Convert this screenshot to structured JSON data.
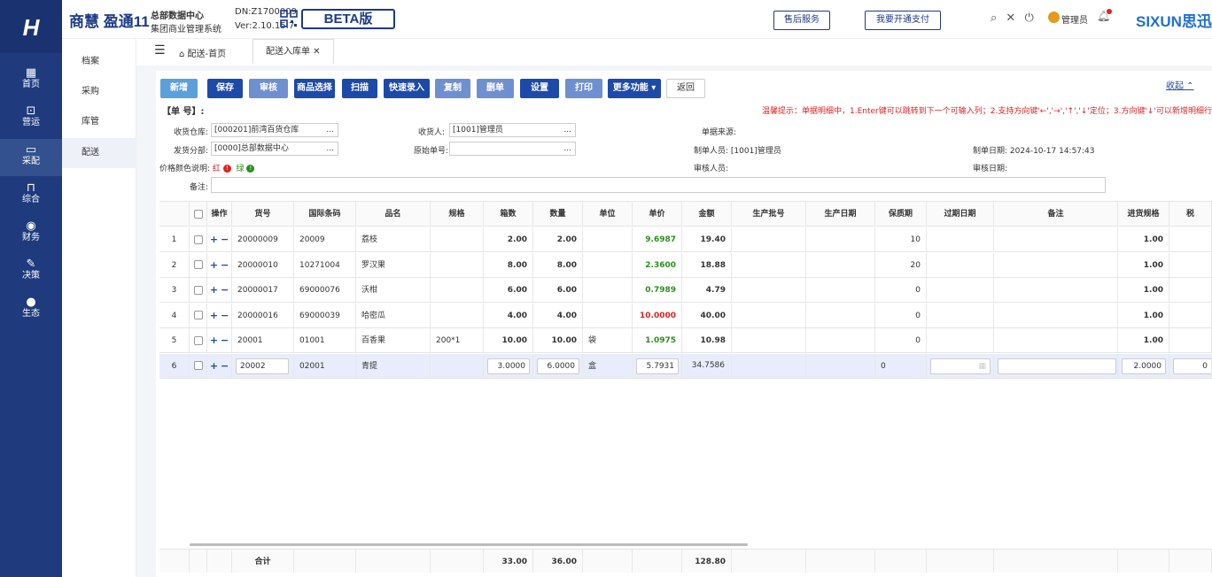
{
  "app": {
    "logo": "H",
    "brand": "商慧 盈通11",
    "company_line1": "总部数据中心",
    "company_line2": "集团商业管理系统",
    "dn": "DN:Z1700009",
    "version": "Ver:2.10.15.7",
    "beta": "BETA版",
    "after_sales": "售后服务",
    "open_payment": "我要开通支付",
    "user": "管理员",
    "vendor_logo": "SIXUN思迅"
  },
  "sidebar": {
    "items": [
      {
        "label": "首页",
        "icon": "▦"
      },
      {
        "label": "营运",
        "icon": "⊡"
      },
      {
        "label": "采配",
        "icon": "▭"
      },
      {
        "label": "综合",
        "icon": "⊓"
      },
      {
        "label": "财务",
        "icon": "◉"
      },
      {
        "label": "决策",
        "icon": "✎"
      },
      {
        "label": "生态",
        "icon": "●"
      }
    ],
    "submenu": [
      "档案",
      "采购",
      "库管",
      "配送"
    ]
  },
  "tabs": {
    "home": "配送-首页",
    "current": "配送入库单 ✕"
  },
  "toolbar": {
    "new": "新增",
    "save": "保存",
    "audit": "审核",
    "select_goods": "商品选择",
    "scan": "扫描",
    "quick_entry": "快速录入",
    "copy": "复制",
    "delete": "删单",
    "settings": "设置",
    "print": "打印",
    "more": "更多功能 ▾",
    "back": "返回",
    "collapse": "收起 ⌃"
  },
  "form": {
    "doc_no_label": "【单 号】:",
    "tip": "温馨提示：单据明细中，1.Enter键可以跳转到下一个可输入列；2.支持方向键'←','→','↑','↓'定位；3.方向键'↓'可以新增明细行。",
    "warehouse_label": "收货仓库:",
    "warehouse_value": "[000201]前湾百货仓库",
    "receiver_label": "收货人:",
    "receiver_value": "[1001]管理员",
    "source_label": "单据来源:",
    "branch_label": "发货分部:",
    "branch_value": "[0000]总部数据中心",
    "orig_no_label": "原始单号:",
    "maker_label": "制单人员:",
    "maker_value": "[1001]管理员",
    "make_date_label": "制单日期:",
    "make_date_value": "2024-10-17 14:57:43",
    "price_color_label": "价格颜色说明:",
    "red_label": "红",
    "green_label": "绿",
    "auditor_label": "审核人员:",
    "audit_date_label": "审核日期:",
    "remark_label": "备注:",
    "ellipsis": "..."
  },
  "table": {
    "headers": {
      "op": "操作",
      "code": "货号",
      "barcode": "国际条码",
      "name": "品名",
      "spec": "规格",
      "boxes": "箱数",
      "qty": "数量",
      "unit": "单位",
      "price": "单价",
      "amount": "金额",
      "batch": "生产批号",
      "mfg": "生产日期",
      "shelf": "保质期",
      "expiry": "过期日期",
      "remark": "备注",
      "purchase_spec": "进货规格",
      "tax": "税"
    },
    "rows": [
      {
        "no": "1",
        "code": "20000009",
        "barcode": "20009",
        "name": "荔枝",
        "spec": "",
        "boxes": "2.00",
        "qty": "2.00",
        "unit": "",
        "price": "9.6987",
        "price_color": "green",
        "amount": "19.40",
        "shelf": "10",
        "purchase_spec": "1.00"
      },
      {
        "no": "2",
        "code": "20000010",
        "barcode": "10271004",
        "name": "罗汉果",
        "spec": "",
        "boxes": "8.00",
        "qty": "8.00",
        "unit": "",
        "price": "2.3600",
        "price_color": "green",
        "amount": "18.88",
        "shelf": "20",
        "purchase_spec": "1.00"
      },
      {
        "no": "3",
        "code": "20000017",
        "barcode": "69000076",
        "name": "沃柑",
        "spec": "",
        "boxes": "6.00",
        "qty": "6.00",
        "unit": "",
        "price": "0.7989",
        "price_color": "green",
        "amount": "4.79",
        "shelf": "0",
        "purchase_spec": "1.00"
      },
      {
        "no": "4",
        "code": "20000016",
        "barcode": "69000039",
        "name": "哈密瓜",
        "spec": "",
        "boxes": "4.00",
        "qty": "4.00",
        "unit": "",
        "price": "10.0000",
        "price_color": "red",
        "amount": "40.00",
        "shelf": "0",
        "purchase_spec": "1.00"
      },
      {
        "no": "5",
        "code": "20001",
        "barcode": "01001",
        "name": "百香果",
        "spec": "200*1",
        "boxes": "10.00",
        "qty": "10.00",
        "unit": "袋",
        "price": "1.0975",
        "price_color": "green",
        "amount": "10.98",
        "shelf": "0",
        "purchase_spec": "1.00"
      }
    ],
    "edit_row": {
      "no": "6",
      "code": "20002",
      "barcode": "02001",
      "name": "青提",
      "boxes": "3.0000",
      "qty": "6.0000",
      "unit": "盒",
      "price": "5.7931",
      "amount": "34.7586",
      "shelf": "0",
      "purchase_spec": "2.0000",
      "tax": "0"
    },
    "footer": {
      "label": "合计",
      "boxes": "33.00",
      "qty": "36.00",
      "amount": "128.80"
    }
  }
}
